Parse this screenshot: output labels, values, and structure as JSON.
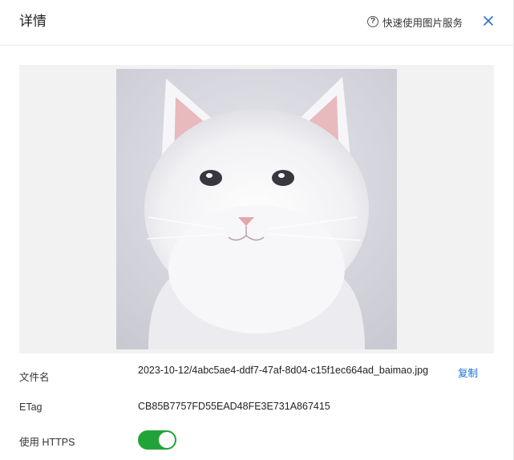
{
  "header": {
    "title": "详情",
    "help_label": "快速使用图片服务"
  },
  "preview": {
    "image_icon": "white-cat-photo"
  },
  "details": {
    "filename_label": "文件名",
    "filename_value": "2023-10-12/4abc5ae4-ddf7-47af-8d04-c15f1ec664ad_baimao.jpg",
    "copy_label": "复制",
    "etag_label": "ETag",
    "etag_value": "CB85B7757FD55EAD48FE3E731A867415",
    "https_label": "使用 HTTPS",
    "https_enabled": true
  },
  "colors": {
    "accent_link": "#1a6fd6",
    "toggle_on": "#22a33a"
  }
}
